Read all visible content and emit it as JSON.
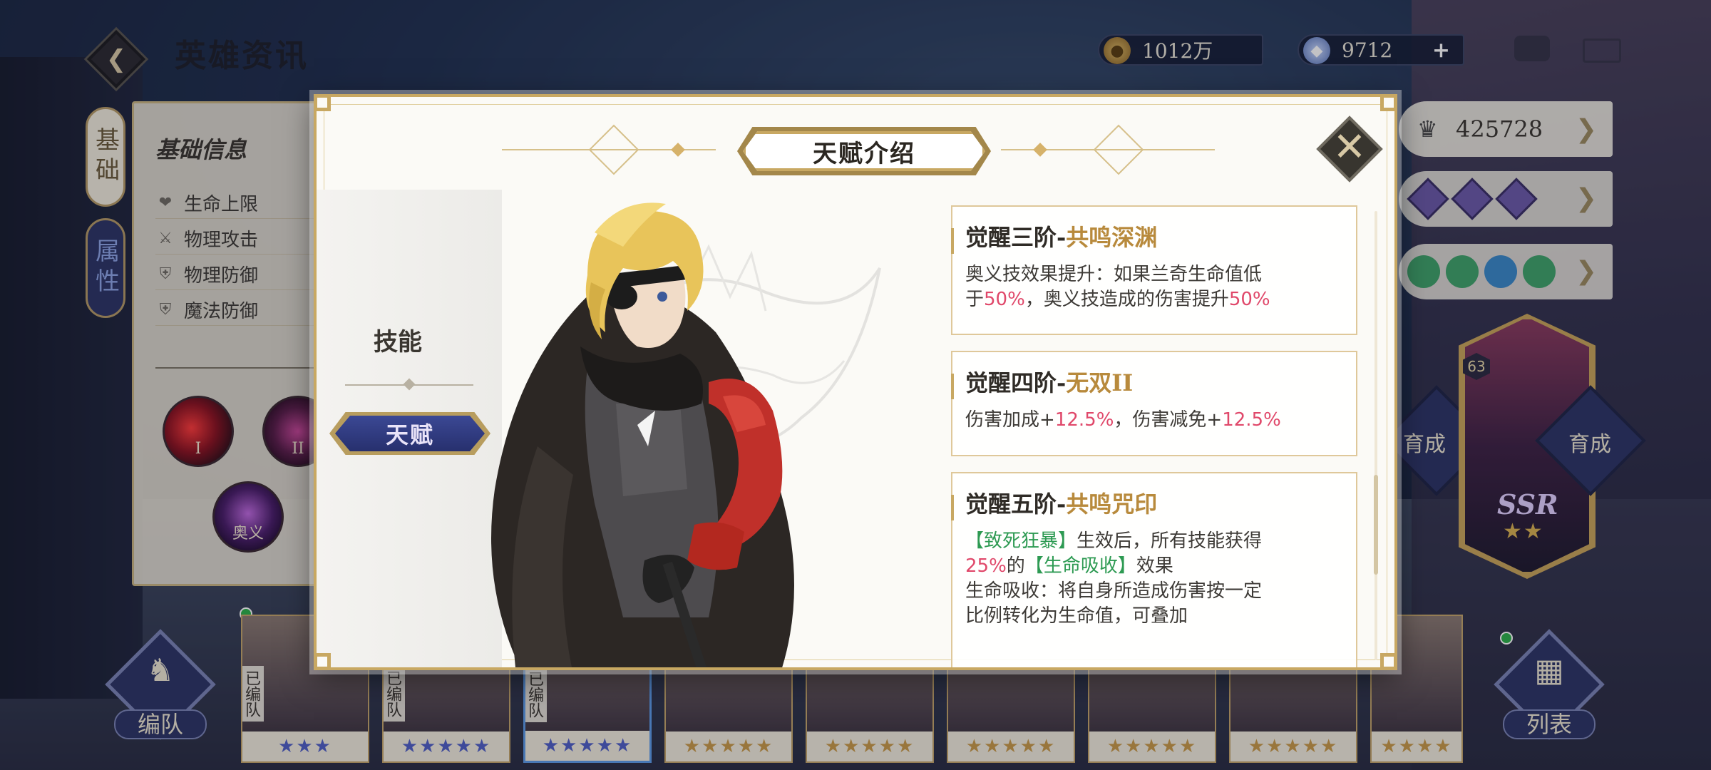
{
  "header": {
    "title": "英雄资讯",
    "gold": "1012万",
    "gems": "9712",
    "plus": "+"
  },
  "side_tabs": [
    {
      "label": "基础"
    },
    {
      "label": "属性"
    }
  ],
  "info_panel": {
    "title": "基础信息",
    "stats": [
      "生命上限",
      "物理攻击",
      "物理防御",
      "魔法防御"
    ],
    "skills": [
      "I",
      "II",
      "奥义"
    ]
  },
  "right_panel": {
    "power": "425728",
    "grow_label_left": "育成",
    "grow_label_right": "育成",
    "hero_level": "63",
    "hero_rarity": "SSR",
    "hero_stars": "★★"
  },
  "bottom": {
    "team_button": "编队",
    "list_button": "列表",
    "roster": [
      {
        "in_team": "已编队",
        "stars": "★★★",
        "star_color": "blue"
      },
      {
        "in_team": "已编队",
        "stars": "★★★★★",
        "star_color": "blue"
      },
      {
        "in_team": "已编队",
        "stars": "★★★★★",
        "star_color": "blue"
      },
      {
        "in_team": "",
        "stars": "★★★★★",
        "star_color": "gold"
      },
      {
        "in_team": "",
        "stars": "★★★★★",
        "star_color": "gold"
      },
      {
        "in_team": "",
        "stars": "★★★★★",
        "star_color": "gold"
      },
      {
        "in_team": "",
        "stars": "★★★★★",
        "star_color": "gold"
      },
      {
        "in_team": "",
        "stars": "★★★★★",
        "star_color": "gold"
      },
      {
        "in_team": "",
        "stars": "★★★★",
        "star_color": "gold"
      }
    ]
  },
  "modal": {
    "title": "天赋介绍",
    "tabs": {
      "skill": "技能",
      "talent": "天赋"
    },
    "talents": [
      {
        "prefix": "觉醒三阶-",
        "name": "共鸣深渊",
        "line1_a": "奥义技效果提升：如果兰奇生命值低",
        "line2_a": "于",
        "line2_b": "50%",
        "line2_c": "，奥义技造成的伤害提升",
        "line2_d": "50%"
      },
      {
        "prefix": "觉醒四阶-",
        "name": "无双II",
        "line1_a": "伤害加成+",
        "line1_b": "12.5%",
        "line1_c": "，伤害减免+",
        "line1_d": "12.5%"
      },
      {
        "prefix": "觉醒五阶-",
        "name": "共鸣咒印",
        "line1_a": "【致死狂暴】",
        "line1_b": "生效后，所有技能获得",
        "line2_a": "25%",
        "line2_b": "的",
        "line2_c": "【生命吸收】",
        "line2_d": "效果",
        "line3": "生命吸收：将自身所造成伤害按一定",
        "line4": "比例转化为生命值，可叠加"
      }
    ]
  },
  "colors": {
    "gold_accent": "#c8a862",
    "highlight_red": "#e0486a",
    "highlight_green": "#2d9a52",
    "talent_name": "#b88a3c",
    "navy": "#2c3466"
  }
}
